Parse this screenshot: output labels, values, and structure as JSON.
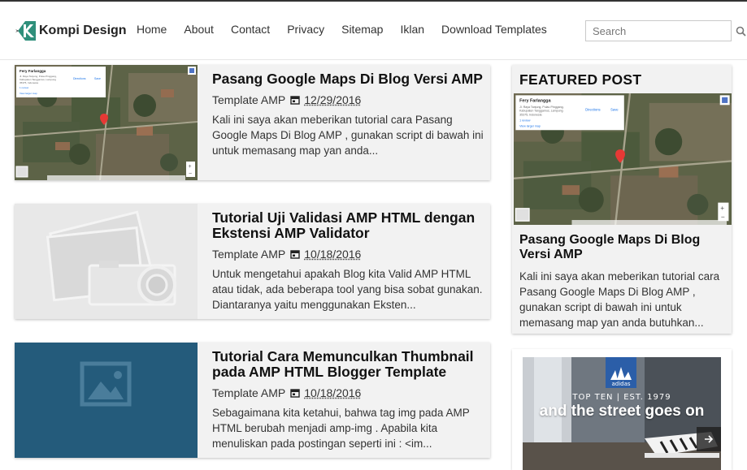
{
  "site": {
    "name": "Kompi Design",
    "accent": "#2f8f7b"
  },
  "nav": {
    "items": [
      {
        "label": "Home"
      },
      {
        "label": "About"
      },
      {
        "label": "Contact"
      },
      {
        "label": "Privacy"
      },
      {
        "label": "Sitemap"
      },
      {
        "label": "Iklan"
      },
      {
        "label": "Download Templates"
      }
    ]
  },
  "search": {
    "placeholder": "Search",
    "icon": "search-icon"
  },
  "posts": [
    {
      "title": "Pasang Google Maps Di Blog Versi AMP",
      "category": "Template AMP",
      "date": "12/29/2016",
      "excerpt": "Kali ini saya akan meberikan tutorial cara Pasang Google Maps Di Blog AMP , gunakan script di bawah ini untuk memasang map yan anda...",
      "thumbnail": "map-thumbnail",
      "map_card": {
        "name": "Fery Farlangga",
        "address": "Jl. Raya Tanjung, Pulau Pinggang, Kabupaten Tanggamus, Lampung 35375, Indonesia",
        "directions": "Directions",
        "save": "Save",
        "reviews": "1 review",
        "larger_map": "View larger map"
      }
    },
    {
      "title": "Tutorial Uji Validasi AMP HTML dengan Ekstensi AMP Validator",
      "category": "Template AMP",
      "date": "10/18/2016",
      "excerpt": "Untuk mengetahui apakah Blog kita Valid AMP HTML atau tidak, ada beberapa tool yang bisa sobat gunakan. Diantaranya yaitu menggunakan Eksten...",
      "thumbnail": "camera-placeholder"
    },
    {
      "title": "Tutorial Cara Memunculkan Thumbnail pada AMP HTML Blogger Template",
      "category": "Template AMP",
      "date": "10/18/2016",
      "excerpt": "Sebagaimana kita ketahui, bahwa tag img pada AMP HTML berubah menjadi amp-img . Apabila kita menuliskan pada postingan seperti ini : <im...",
      "thumbnail": "image-placeholder",
      "thumb_color": "#245b7b"
    }
  ],
  "featured": {
    "heading": "FEATURED POST",
    "title": "Pasang Google Maps Di Blog Versi AMP",
    "excerpt": "Kali ini saya akan meberikan tutorial cara Pasang Google Maps Di Blog AMP , gunakan script di bawah ini untuk memasang map yan anda butuhkan..."
  },
  "ad": {
    "brand": "adidas",
    "tagline_small": "TOP TEN | EST. 1979",
    "tagline": "and the street goes on",
    "next_icon": "arrow-right-icon"
  }
}
